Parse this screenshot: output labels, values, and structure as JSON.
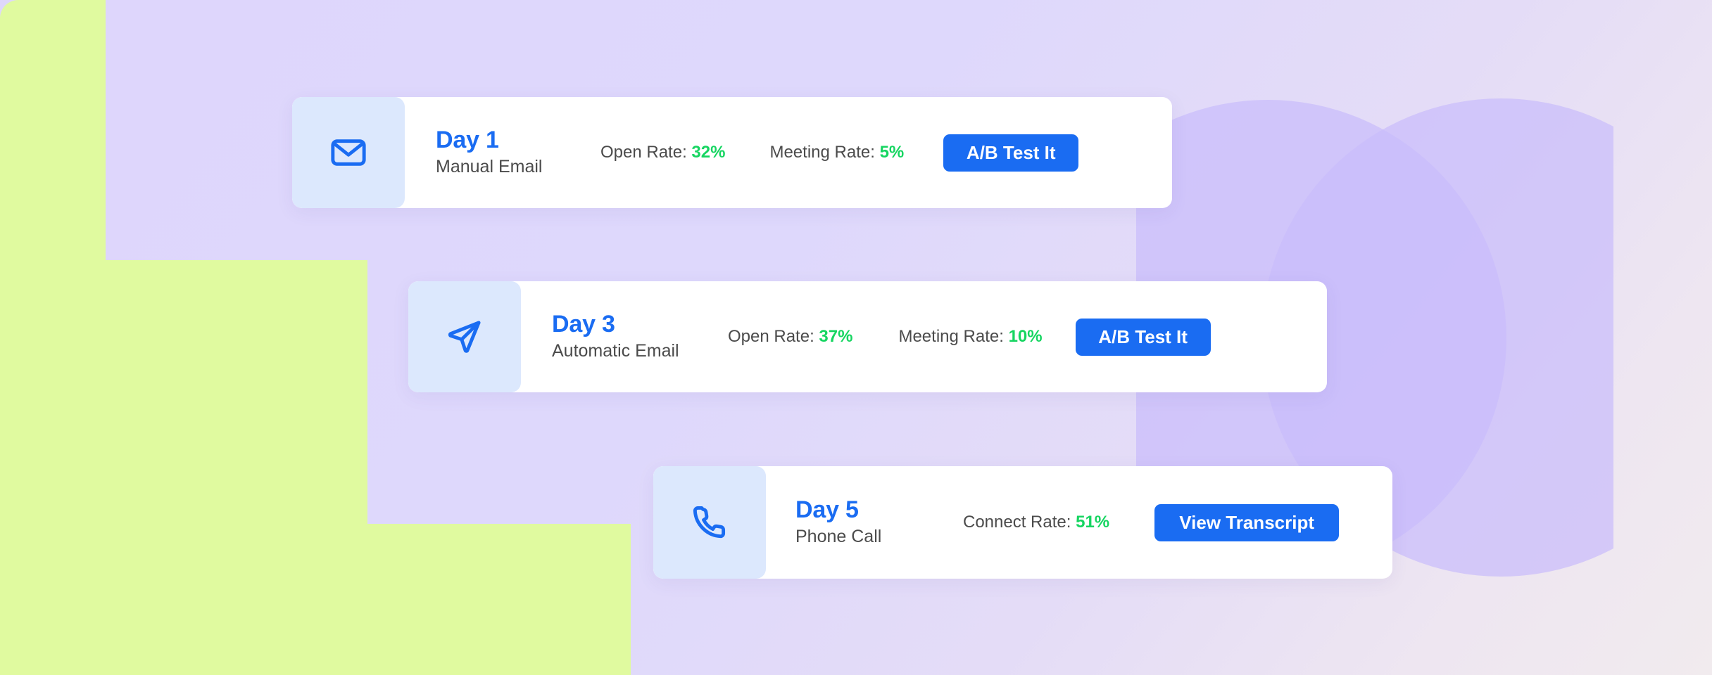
{
  "background": {
    "accent_green": "#e0fa9f",
    "accent_purple": "#ded7fb",
    "circle_purple": "#c9bdfb"
  },
  "theme": {
    "brand_blue": "#1a6cf2",
    "icon_panel_blue": "#dce8fd",
    "success_green": "#16d561",
    "body_text": "#4b4b4b",
    "card_white": "#ffffff"
  },
  "cards": [
    {
      "icon": "envelope-icon",
      "day": "Day 1",
      "type": "Manual Email",
      "metrics": [
        {
          "label": "Open Rate: ",
          "value": "32%"
        },
        {
          "label": "Meeting Rate: ",
          "value": "5%"
        }
      ],
      "cta": "A/B Test It"
    },
    {
      "icon": "paper-plane-icon",
      "day": "Day 3",
      "type": "Automatic Email",
      "metrics": [
        {
          "label": "Open Rate: ",
          "value": "37%"
        },
        {
          "label": "Meeting Rate: ",
          "value": "10%"
        }
      ],
      "cta": "A/B Test It"
    },
    {
      "icon": "phone-icon",
      "day": "Day 5",
      "type": "Phone Call",
      "metrics": [
        {
          "label": "Connect Rate: ",
          "value": "51%"
        }
      ],
      "cta": "View Transcript"
    }
  ]
}
